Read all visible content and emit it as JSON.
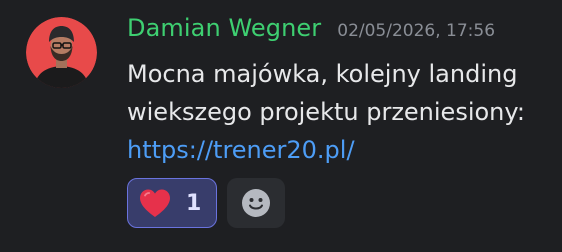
{
  "message": {
    "author": "Damian Wegner",
    "timestamp": "02/05/2026, 17:56",
    "lines": [
      "Mocna majówka, kolejny landing",
      "wiekszego projektu przeniesiony:"
    ],
    "link": "https://trener20.pl/"
  },
  "reactions": [
    {
      "emoji": "heart-icon",
      "count": "1",
      "active": true
    }
  ],
  "add_reaction": {
    "icon": "smiley-icon"
  },
  "colors": {
    "background": "#1e1f22",
    "username": "#3ecf71",
    "link": "#4d9df6",
    "reaction_active_bg": "#383d6b",
    "reaction_active_border": "#6a73de",
    "avatar_bg": "#e84a4a"
  }
}
